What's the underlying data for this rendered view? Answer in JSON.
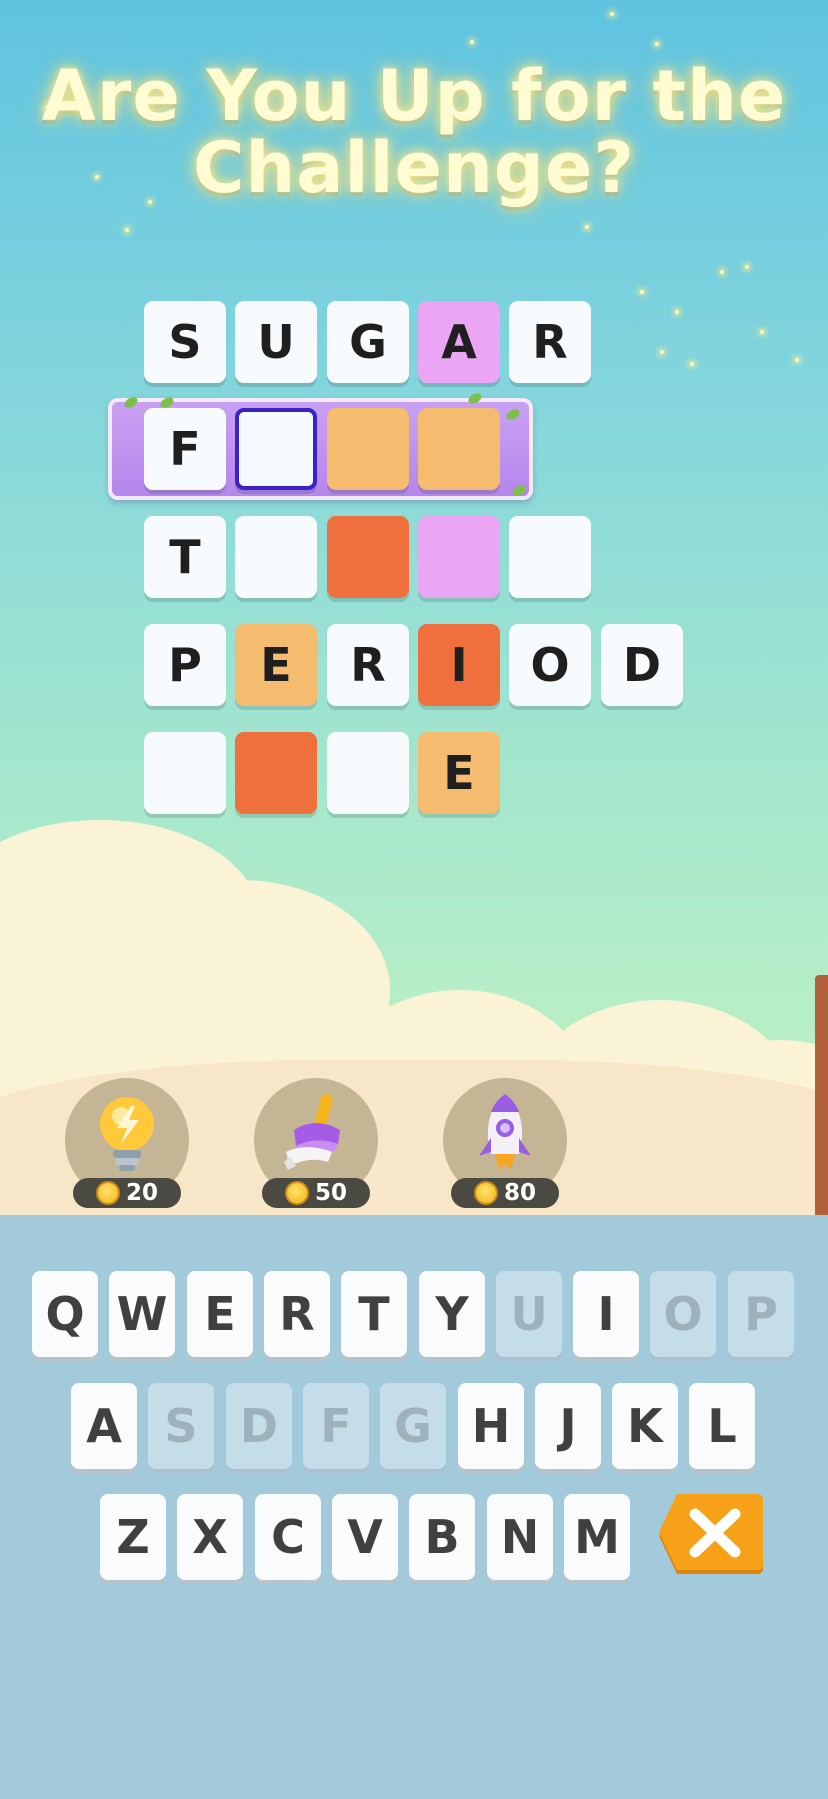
{
  "headline": "Are You Up for the Challenge?",
  "board": {
    "rows": [
      [
        {
          "letter": "S",
          "state": "white"
        },
        {
          "letter": "U",
          "state": "white"
        },
        {
          "letter": "G",
          "state": "white"
        },
        {
          "letter": "A",
          "state": "pink"
        },
        {
          "letter": "R",
          "state": "white"
        }
      ],
      [
        {
          "letter": "F",
          "state": "white"
        },
        {
          "letter": "",
          "state": "cursor"
        },
        {
          "letter": "",
          "state": "orange"
        },
        {
          "letter": "",
          "state": "orange"
        }
      ],
      [
        {
          "letter": "T",
          "state": "white"
        },
        {
          "letter": "",
          "state": "white"
        },
        {
          "letter": "",
          "state": "red"
        },
        {
          "letter": "",
          "state": "pink"
        },
        {
          "letter": "",
          "state": "white"
        }
      ],
      [
        {
          "letter": "P",
          "state": "white"
        },
        {
          "letter": "E",
          "state": "orange"
        },
        {
          "letter": "R",
          "state": "white"
        },
        {
          "letter": "I",
          "state": "red"
        },
        {
          "letter": "O",
          "state": "white"
        },
        {
          "letter": "D",
          "state": "white"
        }
      ],
      [
        {
          "letter": "",
          "state": "white"
        },
        {
          "letter": "",
          "state": "red"
        },
        {
          "letter": "",
          "state": "white"
        },
        {
          "letter": "E",
          "state": "orange"
        }
      ]
    ],
    "colors": {
      "white": "#f8fbfd",
      "pink": "#eaa5f5",
      "orange": "#f5bb6e",
      "red": "#ef6f3d",
      "highlight": "#b98bee",
      "cursor_border": "#3a22c4"
    }
  },
  "boosters": [
    {
      "icon": "lightbulb-icon",
      "cost": "20"
    },
    {
      "icon": "brush-icon",
      "cost": "50"
    },
    {
      "icon": "rocket-icon",
      "cost": "80"
    }
  ],
  "keyboard": {
    "rows": [
      [
        {
          "k": "Q",
          "dim": false
        },
        {
          "k": "W",
          "dim": false
        },
        {
          "k": "E",
          "dim": false
        },
        {
          "k": "R",
          "dim": false
        },
        {
          "k": "T",
          "dim": false
        },
        {
          "k": "Y",
          "dim": false
        },
        {
          "k": "U",
          "dim": true
        },
        {
          "k": "I",
          "dim": false
        },
        {
          "k": "O",
          "dim": true
        },
        {
          "k": "P",
          "dim": true
        }
      ],
      [
        {
          "k": "A",
          "dim": false
        },
        {
          "k": "S",
          "dim": true
        },
        {
          "k": "D",
          "dim": true
        },
        {
          "k": "F",
          "dim": true
        },
        {
          "k": "G",
          "dim": true
        },
        {
          "k": "H",
          "dim": false
        },
        {
          "k": "J",
          "dim": false
        },
        {
          "k": "K",
          "dim": false
        },
        {
          "k": "L",
          "dim": false
        }
      ],
      [
        {
          "k": "Z",
          "dim": false
        },
        {
          "k": "X",
          "dim": false
        },
        {
          "k": "C",
          "dim": false
        },
        {
          "k": "V",
          "dim": false
        },
        {
          "k": "B",
          "dim": false
        },
        {
          "k": "N",
          "dim": false
        },
        {
          "k": "M",
          "dim": false
        }
      ]
    ],
    "delete_icon": "close-icon",
    "delete_color": "#f6a117"
  }
}
